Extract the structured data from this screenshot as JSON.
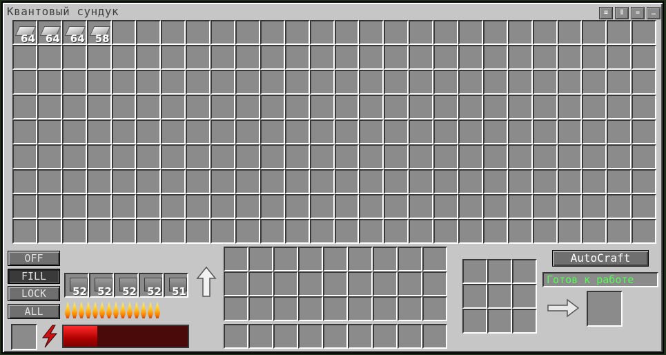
{
  "window": {
    "title": "Квантовый сундук"
  },
  "title_buttons": [
    {
      "name": "sort-column-icon",
      "glyph": "≡"
    },
    {
      "name": "sort-row-icon",
      "glyph": "Ⅱ"
    },
    {
      "name": "sort-by-name-icon",
      "glyph": "="
    },
    {
      "name": "sort-by-count-icon",
      "glyph": "…"
    }
  ],
  "chest_slots": [
    {
      "count": "64"
    },
    {
      "count": "64"
    },
    {
      "count": "64"
    },
    {
      "count": "58"
    }
  ],
  "modes": {
    "off": "OFF",
    "fill": "FILL",
    "lock": "LOCK",
    "all": "ALL",
    "active": "fill"
  },
  "output_slots": [
    {
      "count": "52"
    },
    {
      "count": "52"
    },
    {
      "count": "52"
    },
    {
      "count": "52"
    },
    {
      "count": "51"
    }
  ],
  "progress_flames": 14,
  "energy": {
    "fraction": 0.27,
    "color": "#d00000"
  },
  "autocraft": {
    "label": "AutoCraft",
    "status": "Готов к работе",
    "status_color": "#55ff55"
  },
  "icons": {
    "energy": "lightning-bolt-icon",
    "arrow_up": "arrow-up-icon",
    "arrow_right": "arrow-right-icon"
  }
}
